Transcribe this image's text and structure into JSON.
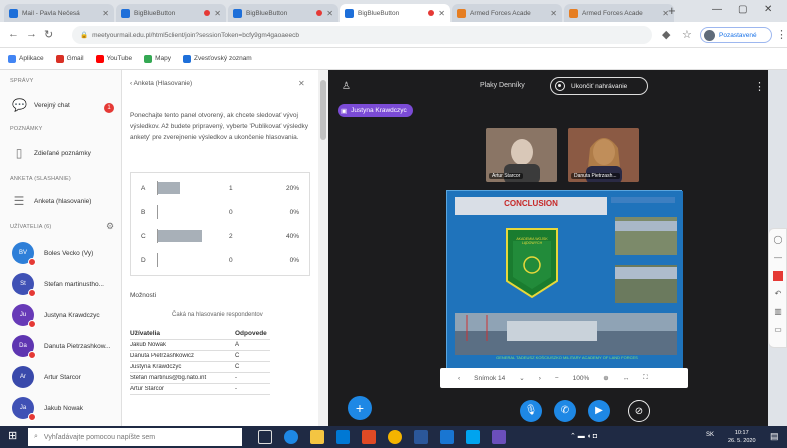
{
  "browser": {
    "tabs": [
      {
        "title": "Mail - Pavla Nečesá",
        "color": "#1e6fd9",
        "active": false,
        "recording": false
      },
      {
        "title": "BigBlueButton",
        "color": "#1e6fd9",
        "active": false,
        "recording": true
      },
      {
        "title": "BigBlueButton",
        "color": "#1e6fd9",
        "active": false,
        "recording": true
      },
      {
        "title": "BigBlueButton",
        "color": "#1e6fd9",
        "active": true,
        "recording": true
      },
      {
        "title": "Armed Forces Acade",
        "color": "#e67e22",
        "active": false,
        "recording": false
      },
      {
        "title": "Armed Forces Acade",
        "color": "#e67e22",
        "active": false,
        "recording": false
      }
    ],
    "url": "meetyourmail.edu.pl/html5client/join?sessionToken=bcfy9gm4gaoaeecb",
    "profile_label": "Pozastavené",
    "bookmarks": [
      {
        "label": "Aplikace",
        "color": "#4285f4"
      },
      {
        "label": "Gmail",
        "color": "#d93025"
      },
      {
        "label": "YouTube",
        "color": "#ff0000"
      },
      {
        "label": "Mapy",
        "color": "#34a853"
      },
      {
        "label": "Zvesťovský zoznam",
        "color": "#1e6fd9"
      }
    ]
  },
  "sidebar": {
    "messages_title": "SPRÁVY",
    "public_chat": "Verejný chat",
    "public_chat_badge": "1",
    "notes_title": "POZNÁMKY",
    "shared_notes": "Zdieľané poznámky",
    "polls_title": "ANKETA (SLASHANIE)",
    "poll_item": "Anketa (hlasovanie)",
    "users_title": "UŽÍVATELIA (6)",
    "users": [
      {
        "name": "Boles Vecko (Vy)",
        "initials": "BV",
        "color": "#2e7fd8",
        "muted": true
      },
      {
        "name": "Stefan martinustho...",
        "initials": "St",
        "color": "#3f51b5",
        "muted": true
      },
      {
        "name": "Justyna Krawdczyc",
        "initials": "Ju",
        "color": "#673ab7",
        "muted": true
      },
      {
        "name": "Danuta Pietrzashkow...",
        "initials": "Da",
        "color": "#5e35b1",
        "muted": true
      },
      {
        "name": "Artur Starcor",
        "initials": "Ar",
        "color": "#3949ab",
        "muted": false
      },
      {
        "name": "Jakub Nowak",
        "initials": "Ja",
        "color": "#3f51b5",
        "muted": true
      }
    ]
  },
  "poll": {
    "header": "Anketa (Hlasovanie)",
    "description": "Ponechajte tento panel otvorený, ak chcete sledovať vývoj výsledkov. Až budete pripravený, vyberte 'Publikovať výsledky ankety' pre zverejnenie výsledkov a ukončenie hlasovania.",
    "options": [
      {
        "label": "A",
        "count": "1",
        "percent": "20%",
        "value": 20
      },
      {
        "label": "B",
        "count": "0",
        "percent": "0%",
        "value": 0
      },
      {
        "label": "C",
        "count": "2",
        "percent": "40%",
        "value": 40
      },
      {
        "label": "D",
        "count": "0",
        "percent": "0%",
        "value": 0
      }
    ],
    "responses_label": "Možnosti",
    "waiting_label": "Čaká na hlasovanie respondentov",
    "table_headers": [
      "Užívatelia",
      "Odpovede"
    ],
    "responses": [
      {
        "user": "Jakub Nowak",
        "answer": "A"
      },
      {
        "user": "Danuta Pietrzashkowicz",
        "answer": "C"
      },
      {
        "user": "Justyna Krawdczyc",
        "answer": "C"
      },
      {
        "user": "Stefan martinus@bg.nato.int",
        "answer": "-"
      },
      {
        "user": "Artur Starcor",
        "answer": "-"
      }
    ]
  },
  "meeting": {
    "title": "Plaky Denníky",
    "record_label": "Ukončiť nahrávanie",
    "presenter": "Justyna Krawdczyc",
    "webcams": [
      {
        "name": "Artur Starcor",
        "bg": "#6b5a4e",
        "face": "#d9c8b8"
      },
      {
        "name": "Danuta Pietrzash...",
        "bg": "#7a4c3a",
        "face": "#e1b49a"
      }
    ],
    "slide_title": "CONCLUSION",
    "slide_emblem_text": "AKADEMIA WOJSK LĄDOWYCH",
    "slide_footer": "GENERAL TADEUSZ KOŚCIUSZKO MILITARY ACADEMY OF LAND FORCES",
    "slide_page": "Snímok 14",
    "slide_zoom": "100%",
    "colors": {
      "bg": "#1c1c1e",
      "accent": "#1e88e5",
      "presenter": "#7b4bd6"
    }
  },
  "taskbar": {
    "search_placeholder": "Vyhľadávajte pomocou napíšte sem",
    "time": "10:17",
    "date": "26. 5. 2020",
    "lang": "SK"
  }
}
